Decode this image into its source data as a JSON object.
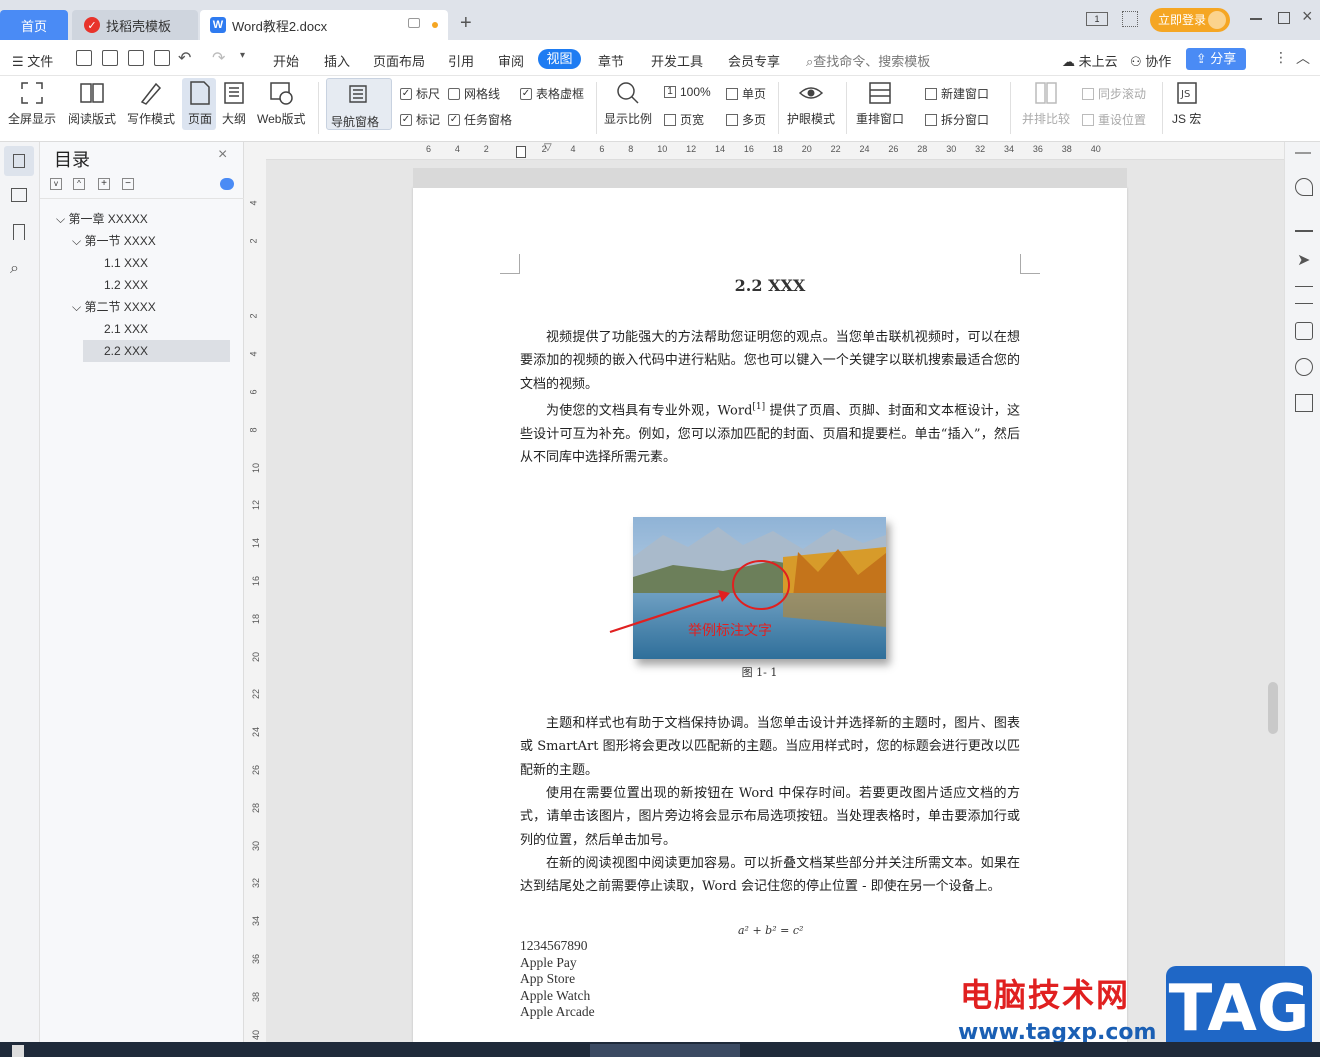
{
  "tabs": {
    "home": "首页",
    "template": "找稻壳模板",
    "doc": "Word教程2.docx",
    "new": "+"
  },
  "titlebar": {
    "login": "立即登录"
  },
  "menu": {
    "file": "文件",
    "items": [
      "开始",
      "插入",
      "页面布局",
      "引用",
      "审阅",
      "视图",
      "章节",
      "开发工具",
      "会员专享"
    ],
    "active": "视图",
    "search": "查找命令、搜索模板",
    "cloud": "未上云",
    "collab": "协作",
    "share": "分享"
  },
  "ribbon": {
    "fullscreen": "全屏显示",
    "reading": "阅读版式",
    "writing": "写作模式",
    "page": "页面",
    "outline": "大纲",
    "web": "Web版式",
    "nav_pane": "导航窗格",
    "ruler": "标尺",
    "grid": "网格线",
    "table_grid": "表格虚框",
    "markers": "标记",
    "task_pane": "任务窗格",
    "zoom_display": "显示比例",
    "zoom_100": "100%",
    "page_width": "页宽",
    "single": "单页",
    "multi": "多页",
    "eye": "护眼模式",
    "rearrange": "重排窗口",
    "new_window": "新建窗口",
    "split": "拆分窗口",
    "side_by_side": "并排比较",
    "sync_scroll": "同步滚动",
    "reset_pos": "重设位置",
    "macro": "JS 宏"
  },
  "toc": {
    "title": "目录",
    "items": [
      {
        "label": "第一章  XXXXX",
        "level": 0
      },
      {
        "label": "第一节  XXXX",
        "level": 1
      },
      {
        "label": "1.1 XXX",
        "level": 2
      },
      {
        "label": "1.2 XXX",
        "level": 2
      },
      {
        "label": "第二节  XXXX",
        "level": 1
      },
      {
        "label": "2.1 XXX",
        "level": 2
      },
      {
        "label": "2.2 XXX",
        "level": 2
      }
    ],
    "selected": "2.2 XXX"
  },
  "ruler_h": [
    "6",
    "4",
    "2",
    "",
    "2",
    "4",
    "6",
    "8",
    "10",
    "12",
    "14",
    "16",
    "18",
    "20",
    "22",
    "24",
    "26",
    "28",
    "30",
    "32",
    "34",
    "36",
    "38",
    "40"
  ],
  "ruler_v": [
    "4",
    "2",
    "",
    "2",
    "4",
    "6",
    "8",
    "10",
    "12",
    "14",
    "16",
    "18",
    "20",
    "22",
    "24",
    "26",
    "28",
    "30",
    "32",
    "34",
    "36",
    "38",
    "40"
  ],
  "document": {
    "heading": "2.2 XXX",
    "p1": "视频提供了功能强大的方法帮助您证明您的观点。当您单击联机视频时，可以在想要添加的视频的嵌入代码中进行粘贴。您也可以键入一个关键字以联机搜索最适合您的文档的视频。",
    "p2a": "为使您的文档具有专业外观，Word",
    "p2sup": "[1]",
    "p2b": " 提供了页眉、页脚、封面和文本框设计，这些设计可互为补充。例如，您可以添加匹配的封面、页眉和提要栏。单击“插入”，然后从不同库中选择所需元素。",
    "annotation": "举例标注文字",
    "caption": "图 1- 1",
    "p3": "主题和样式也有助于文档保持协调。当您单击设计并选择新的主题时，图片、图表或 SmartArt 图形将会更改以匹配新的主题。当应用样式时，您的标题会进行更改以匹配新的主题。",
    "p4": "使用在需要位置出现的新按钮在 Word 中保存时间。若要更改图片适应文档的方式，请单击该图片，图片旁边将会显示布局选项按钮。当处理表格时，单击要添加行或列的位置，然后单击加号。",
    "p5": "在新的阅读视图中阅读更加容易。可以折叠文档某些部分并关注所需文本。如果在达到结尾处之前需要停止读取，Word 会记住您的停止位置 - 即使在另一个设备上。",
    "formula": "a² + b² = c²",
    "lines": [
      "1234567890",
      "Apple Pay",
      "App Store",
      "Apple Watch",
      "Apple Arcade"
    ]
  },
  "watermark": {
    "brand": "电脑技术网",
    "url": "www.tagxp.com",
    "tag": "TAG"
  },
  "colors": {
    "accent": "#4a8bf5",
    "active_tab": "#1e7cf2",
    "login": "#f5a623",
    "brand_red": "#e02020"
  }
}
